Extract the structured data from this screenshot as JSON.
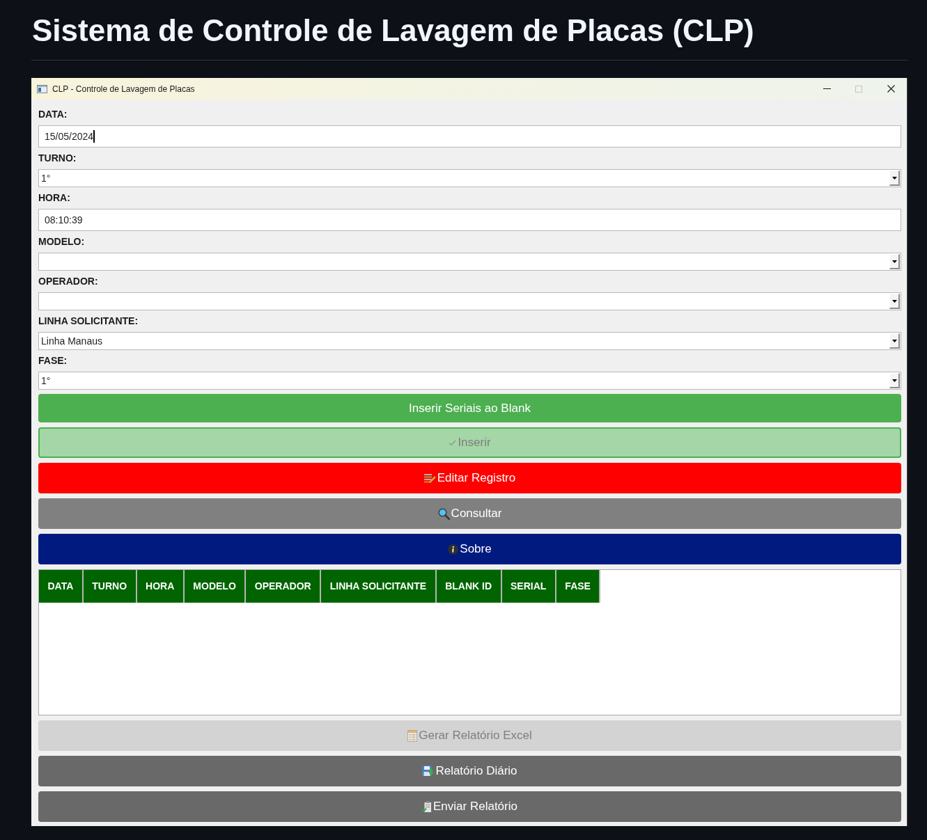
{
  "page": {
    "heading": "Sistema de Controle de Lavagem de Placas (CLP)"
  },
  "window": {
    "title": "CLP - Controle de Lavagem de Placas"
  },
  "fields": [
    {
      "label": "DATA:",
      "kind": "text",
      "value": "15/05/2024",
      "focused": true
    },
    {
      "label": "TURNO:",
      "kind": "combo",
      "value": "1°",
      "focused": false
    },
    {
      "label": "HORA:",
      "kind": "text",
      "value": "08:10:39",
      "focused": false
    },
    {
      "label": "MODELO:",
      "kind": "combo",
      "focused": false
    },
    {
      "label": "OPERADOR:",
      "kind": "combo",
      "focused": false
    },
    {
      "label": "LINHA SOLICITANTE:",
      "kind": "combo",
      "value": "Linha Manaus",
      "focused": false
    },
    {
      "label": "FASE:",
      "kind": "combo",
      "value": "1°",
      "focused": false
    }
  ],
  "buttons": [
    {
      "label": "Inserir Seriais ao Blank",
      "kind": "solid",
      "color": "#4caf50",
      "disabled": false
    },
    {
      "label": "Inserir",
      "kind": "outlined",
      "color": "#a5d6a7",
      "disabled": true
    },
    {
      "label": "Editar Registro",
      "kind": "solid",
      "color": "#ff0000",
      "disabled": false
    },
    {
      "label": "Consultar",
      "kind": "solid",
      "color": "#808080",
      "disabled": false
    },
    {
      "label": "Sobre",
      "kind": "solid",
      "color": "#001a80",
      "disabled": false
    }
  ],
  "table": {
    "columns": [
      "DATA",
      "TURNO",
      "HORA",
      "MODELO",
      "OPERADOR",
      "LINHA SOLICITANTE",
      "BLANK ID",
      "SERIAL",
      "FASE"
    ]
  },
  "report_buttons": [
    {
      "label": "Gerar Relatório Excel",
      "kind": "solid",
      "color": "#d3d3d3",
      "disabled": true
    },
    {
      "label": "Relatório Diário",
      "kind": "solid",
      "color": "#696969",
      "disabled": false
    },
    {
      "label": "Enviar Relatório",
      "kind": "solid",
      "color": "#696969",
      "disabled": false
    }
  ]
}
